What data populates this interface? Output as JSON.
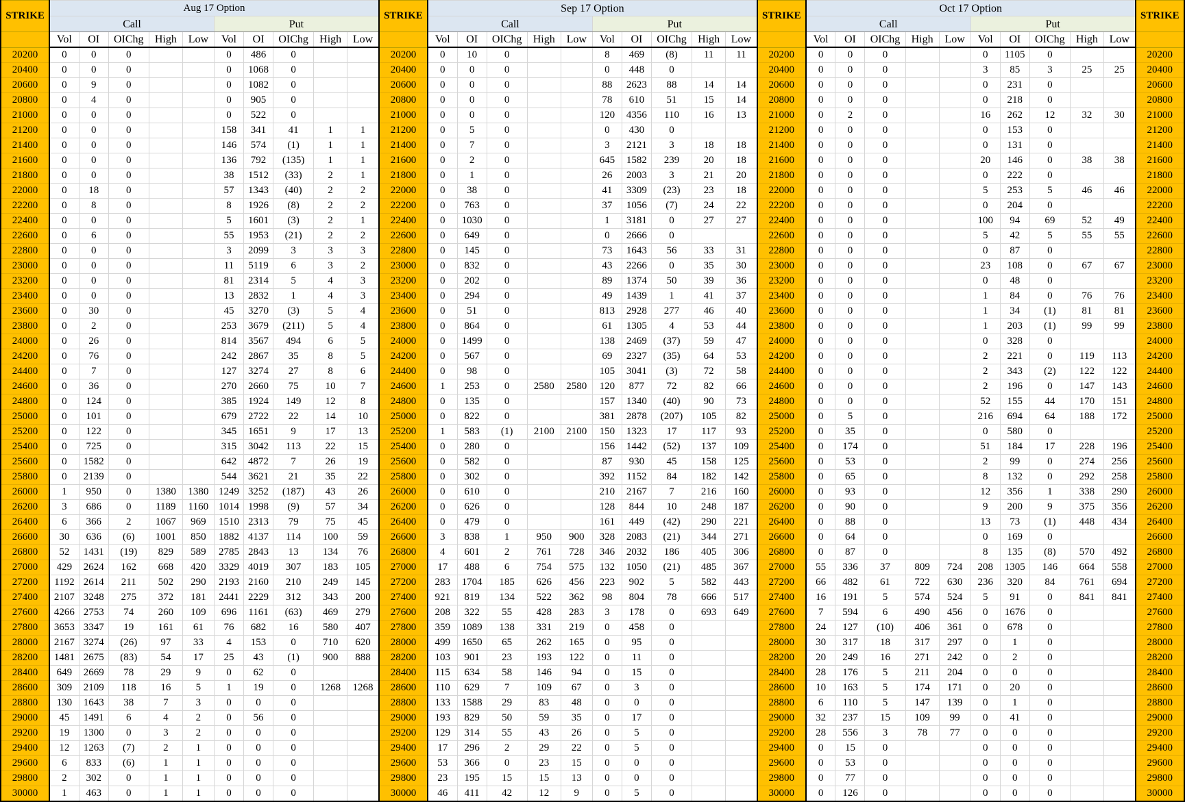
{
  "header": {
    "strike_label": "STRIKE",
    "call_label": "Call",
    "put_label": "Put",
    "sub_columns": [
      "Vol",
      "OI",
      "OIChg",
      "High",
      "Low"
    ]
  },
  "months": [
    "Aug 17 Option",
    "Sep 17 Option",
    "Oct 17 Option"
  ],
  "colors": {
    "strike_bg": "#ffc000",
    "call_bg": "#dce6f1",
    "put_bg": "#ebf1de",
    "negative": "#ff0000"
  },
  "rows": [
    [
      "20200",
      "0",
      "0",
      "0",
      "",
      "",
      "0",
      "486",
      "0",
      "",
      "",
      "0",
      "10",
      "0",
      "",
      "",
      "8",
      "469",
      "(8)",
      "11",
      "11",
      "0",
      "0",
      "0",
      "",
      "",
      "0",
      "1105",
      "0",
      "",
      ""
    ],
    [
      "20400",
      "0",
      "0",
      "0",
      "",
      "",
      "0",
      "1068",
      "0",
      "",
      "",
      "0",
      "0",
      "0",
      "",
      "",
      "0",
      "448",
      "0",
      "",
      "",
      "0",
      "0",
      "0",
      "",
      "",
      "3",
      "85",
      "3",
      "25",
      "25"
    ],
    [
      "20600",
      "0",
      "9",
      "0",
      "",
      "",
      "0",
      "1082",
      "0",
      "",
      "",
      "0",
      "0",
      "0",
      "",
      "",
      "88",
      "2623",
      "88",
      "14",
      "14",
      "0",
      "0",
      "0",
      "",
      "",
      "0",
      "231",
      "0",
      "",
      ""
    ],
    [
      "20800",
      "0",
      "4",
      "0",
      "",
      "",
      "0",
      "905",
      "0",
      "",
      "",
      "0",
      "0",
      "0",
      "",
      "",
      "78",
      "610",
      "51",
      "15",
      "14",
      "0",
      "0",
      "0",
      "",
      "",
      "0",
      "218",
      "0",
      "",
      ""
    ],
    [
      "21000",
      "0",
      "0",
      "0",
      "",
      "",
      "0",
      "522",
      "0",
      "",
      "",
      "0",
      "0",
      "0",
      "",
      "",
      "120",
      "4356",
      "110",
      "16",
      "13",
      "0",
      "2",
      "0",
      "",
      "",
      "16",
      "262",
      "12",
      "32",
      "30"
    ],
    [
      "21200",
      "0",
      "0",
      "0",
      "",
      "",
      "158",
      "341",
      "41",
      "1",
      "1",
      "0",
      "5",
      "0",
      "",
      "",
      "0",
      "430",
      "0",
      "",
      "",
      "0",
      "0",
      "0",
      "",
      "",
      "0",
      "153",
      "0",
      "",
      ""
    ],
    [
      "21400",
      "0",
      "0",
      "0",
      "",
      "",
      "146",
      "574",
      "(1)",
      "1",
      "1",
      "0",
      "7",
      "0",
      "",
      "",
      "3",
      "2121",
      "3",
      "18",
      "18",
      "0",
      "0",
      "0",
      "",
      "",
      "0",
      "131",
      "0",
      "",
      ""
    ],
    [
      "21600",
      "0",
      "0",
      "0",
      "",
      "",
      "136",
      "792",
      "(135)",
      "1",
      "1",
      "0",
      "2",
      "0",
      "",
      "",
      "645",
      "1582",
      "239",
      "20",
      "18",
      "0",
      "0",
      "0",
      "",
      "",
      "20",
      "146",
      "0",
      "38",
      "38"
    ],
    [
      "21800",
      "0",
      "0",
      "0",
      "",
      "",
      "38",
      "1512",
      "(33)",
      "2",
      "1",
      "0",
      "1",
      "0",
      "",
      "",
      "26",
      "2003",
      "3",
      "21",
      "20",
      "0",
      "0",
      "0",
      "",
      "",
      "0",
      "222",
      "0",
      "",
      ""
    ],
    [
      "22000",
      "0",
      "18",
      "0",
      "",
      "",
      "57",
      "1343",
      "(40)",
      "2",
      "2",
      "0",
      "38",
      "0",
      "",
      "",
      "41",
      "3309",
      "(23)",
      "23",
      "18",
      "0",
      "0",
      "0",
      "",
      "",
      "5",
      "253",
      "5",
      "46",
      "46"
    ],
    [
      "22200",
      "0",
      "8",
      "0",
      "",
      "",
      "8",
      "1926",
      "(8)",
      "2",
      "2",
      "0",
      "763",
      "0",
      "",
      "",
      "37",
      "1056",
      "(7)",
      "24",
      "22",
      "0",
      "0",
      "0",
      "",
      "",
      "0",
      "204",
      "0",
      "",
      ""
    ],
    [
      "22400",
      "0",
      "0",
      "0",
      "",
      "",
      "5",
      "1601",
      "(3)",
      "2",
      "1",
      "0",
      "1030",
      "0",
      "",
      "",
      "1",
      "3181",
      "0",
      "27",
      "27",
      "0",
      "0",
      "0",
      "",
      "",
      "100",
      "94",
      "69",
      "52",
      "49"
    ],
    [
      "22600",
      "0",
      "6",
      "0",
      "",
      "",
      "55",
      "1953",
      "(21)",
      "2",
      "2",
      "0",
      "649",
      "0",
      "",
      "",
      "0",
      "2666",
      "0",
      "",
      "",
      "0",
      "0",
      "0",
      "",
      "",
      "5",
      "42",
      "5",
      "55",
      "55"
    ],
    [
      "22800",
      "0",
      "0",
      "0",
      "",
      "",
      "3",
      "2099",
      "3",
      "3",
      "3",
      "0",
      "145",
      "0",
      "",
      "",
      "73",
      "1643",
      "56",
      "33",
      "31",
      "0",
      "0",
      "0",
      "",
      "",
      "0",
      "87",
      "0",
      "",
      ""
    ],
    [
      "23000",
      "0",
      "0",
      "0",
      "",
      "",
      "11",
      "5119",
      "6",
      "3",
      "2",
      "0",
      "832",
      "0",
      "",
      "",
      "43",
      "2266",
      "0",
      "35",
      "30",
      "0",
      "0",
      "0",
      "",
      "",
      "23",
      "108",
      "0",
      "67",
      "67"
    ],
    [
      "23200",
      "0",
      "0",
      "0",
      "",
      "",
      "81",
      "2314",
      "5",
      "4",
      "3",
      "0",
      "202",
      "0",
      "",
      "",
      "89",
      "1374",
      "50",
      "39",
      "36",
      "0",
      "0",
      "0",
      "",
      "",
      "0",
      "48",
      "0",
      "",
      ""
    ],
    [
      "23400",
      "0",
      "0",
      "0",
      "",
      "",
      "13",
      "2832",
      "1",
      "4",
      "3",
      "0",
      "294",
      "0",
      "",
      "",
      "49",
      "1439",
      "1",
      "41",
      "37",
      "0",
      "0",
      "0",
      "",
      "",
      "1",
      "84",
      "0",
      "76",
      "76"
    ],
    [
      "23600",
      "0",
      "30",
      "0",
      "",
      "",
      "45",
      "3270",
      "(3)",
      "5",
      "4",
      "0",
      "51",
      "0",
      "",
      "",
      "813",
      "2928",
      "277",
      "46",
      "40",
      "0",
      "0",
      "0",
      "",
      "",
      "1",
      "34",
      "(1)",
      "81",
      "81"
    ],
    [
      "23800",
      "0",
      "2",
      "0",
      "",
      "",
      "253",
      "3679",
      "(211)",
      "5",
      "4",
      "0",
      "864",
      "0",
      "",
      "",
      "61",
      "1305",
      "4",
      "53",
      "44",
      "0",
      "0",
      "0",
      "",
      "",
      "1",
      "203",
      "(1)",
      "99",
      "99"
    ],
    [
      "24000",
      "0",
      "26",
      "0",
      "",
      "",
      "814",
      "3567",
      "494",
      "6",
      "5",
      "0",
      "1499",
      "0",
      "",
      "",
      "138",
      "2469",
      "(37)",
      "59",
      "47",
      "0",
      "0",
      "0",
      "",
      "",
      "0",
      "328",
      "0",
      "",
      ""
    ],
    [
      "24200",
      "0",
      "76",
      "0",
      "",
      "",
      "242",
      "2867",
      "35",
      "8",
      "5",
      "0",
      "567",
      "0",
      "",
      "",
      "69",
      "2327",
      "(35)",
      "64",
      "53",
      "0",
      "0",
      "0",
      "",
      "",
      "2",
      "221",
      "0",
      "119",
      "113"
    ],
    [
      "24400",
      "0",
      "7",
      "0",
      "",
      "",
      "127",
      "3274",
      "27",
      "8",
      "6",
      "0",
      "98",
      "0",
      "",
      "",
      "105",
      "3041",
      "(3)",
      "72",
      "58",
      "0",
      "0",
      "0",
      "",
      "",
      "2",
      "343",
      "(2)",
      "122",
      "122"
    ],
    [
      "24600",
      "0",
      "36",
      "0",
      "",
      "",
      "270",
      "2660",
      "75",
      "10",
      "7",
      "1",
      "253",
      "0",
      "2580",
      "2580",
      "120",
      "877",
      "72",
      "82",
      "66",
      "0",
      "0",
      "0",
      "",
      "",
      "2",
      "196",
      "0",
      "147",
      "143"
    ],
    [
      "24800",
      "0",
      "124",
      "0",
      "",
      "",
      "385",
      "1924",
      "149",
      "12",
      "8",
      "0",
      "135",
      "0",
      "",
      "",
      "157",
      "1340",
      "(40)",
      "90",
      "73",
      "0",
      "0",
      "0",
      "",
      "",
      "52",
      "155",
      "44",
      "170",
      "151"
    ],
    [
      "25000",
      "0",
      "101",
      "0",
      "",
      "",
      "679",
      "2722",
      "22",
      "14",
      "10",
      "0",
      "822",
      "0",
      "",
      "",
      "381",
      "2878",
      "(207)",
      "105",
      "82",
      "0",
      "5",
      "0",
      "",
      "",
      "216",
      "694",
      "64",
      "188",
      "172"
    ],
    [
      "25200",
      "0",
      "122",
      "0",
      "",
      "",
      "345",
      "1651",
      "9",
      "17",
      "13",
      "1",
      "583",
      "(1)",
      "2100",
      "2100",
      "150",
      "1323",
      "17",
      "117",
      "93",
      "0",
      "35",
      "0",
      "",
      "",
      "0",
      "580",
      "0",
      "",
      ""
    ],
    [
      "25400",
      "0",
      "725",
      "0",
      "",
      "",
      "315",
      "3042",
      "113",
      "22",
      "15",
      "0",
      "280",
      "0",
      "",
      "",
      "156",
      "1442",
      "(52)",
      "137",
      "109",
      "0",
      "174",
      "0",
      "",
      "",
      "51",
      "184",
      "17",
      "228",
      "196"
    ],
    [
      "25600",
      "0",
      "1582",
      "0",
      "",
      "",
      "642",
      "4872",
      "7",
      "26",
      "19",
      "0",
      "582",
      "0",
      "",
      "",
      "87",
      "930",
      "45",
      "158",
      "125",
      "0",
      "53",
      "0",
      "",
      "",
      "2",
      "99",
      "0",
      "274",
      "256"
    ],
    [
      "25800",
      "0",
      "2139",
      "0",
      "",
      "",
      "544",
      "3621",
      "21",
      "35",
      "22",
      "0",
      "302",
      "0",
      "",
      "",
      "392",
      "1152",
      "84",
      "182",
      "142",
      "0",
      "65",
      "0",
      "",
      "",
      "8",
      "132",
      "0",
      "292",
      "258"
    ],
    [
      "26000",
      "1",
      "950",
      "0",
      "1380",
      "1380",
      "1249",
      "3252",
      "(187)",
      "43",
      "26",
      "0",
      "610",
      "0",
      "",
      "",
      "210",
      "2167",
      "7",
      "216",
      "160",
      "0",
      "93",
      "0",
      "",
      "",
      "12",
      "356",
      "1",
      "338",
      "290"
    ],
    [
      "26200",
      "3",
      "686",
      "0",
      "1189",
      "1160",
      "1014",
      "1998",
      "(9)",
      "57",
      "34",
      "0",
      "626",
      "0",
      "",
      "",
      "128",
      "844",
      "10",
      "248",
      "187",
      "0",
      "90",
      "0",
      "",
      "",
      "9",
      "200",
      "9",
      "375",
      "356"
    ],
    [
      "26400",
      "6",
      "366",
      "2",
      "1067",
      "969",
      "1510",
      "2313",
      "79",
      "75",
      "45",
      "0",
      "479",
      "0",
      "",
      "",
      "161",
      "449",
      "(42)",
      "290",
      "221",
      "0",
      "88",
      "0",
      "",
      "",
      "13",
      "73",
      "(1)",
      "448",
      "434"
    ],
    [
      "26600",
      "30",
      "636",
      "(6)",
      "1001",
      "850",
      "1882",
      "4137",
      "114",
      "100",
      "59",
      "3",
      "838",
      "1",
      "950",
      "900",
      "328",
      "2083",
      "(21)",
      "344",
      "271",
      "0",
      "64",
      "0",
      "",
      "",
      "0",
      "169",
      "0",
      "",
      ""
    ],
    [
      "26800",
      "52",
      "1431",
      "(19)",
      "829",
      "589",
      "2785",
      "2843",
      "13",
      "134",
      "76",
      "4",
      "601",
      "2",
      "761",
      "728",
      "346",
      "2032",
      "186",
      "405",
      "306",
      "0",
      "87",
      "0",
      "",
      "",
      "8",
      "135",
      "(8)",
      "570",
      "492"
    ],
    [
      "27000",
      "429",
      "2624",
      "162",
      "668",
      "420",
      "3329",
      "4019",
      "307",
      "183",
      "105",
      "17",
      "488",
      "6",
      "754",
      "575",
      "132",
      "1050",
      "(21)",
      "485",
      "367",
      "55",
      "336",
      "37",
      "809",
      "724",
      "208",
      "1305",
      "146",
      "664",
      "558"
    ],
    [
      "27200",
      "1192",
      "2614",
      "211",
      "502",
      "290",
      "2193",
      "2160",
      "210",
      "249",
      "145",
      "283",
      "1704",
      "185",
      "626",
      "456",
      "223",
      "902",
      "5",
      "582",
      "443",
      "66",
      "482",
      "61",
      "722",
      "630",
      "236",
      "320",
      "84",
      "761",
      "694"
    ],
    [
      "27400",
      "2107",
      "3248",
      "275",
      "372",
      "181",
      "2441",
      "2229",
      "312",
      "343",
      "200",
      "921",
      "819",
      "134",
      "522",
      "362",
      "98",
      "804",
      "78",
      "666",
      "517",
      "16",
      "191",
      "5",
      "574",
      "524",
      "5",
      "91",
      "0",
      "841",
      "841"
    ],
    [
      "27600",
      "4266",
      "2753",
      "74",
      "260",
      "109",
      "696",
      "1161",
      "(63)",
      "469",
      "279",
      "208",
      "322",
      "55",
      "428",
      "283",
      "3",
      "178",
      "0",
      "693",
      "649",
      "7",
      "594",
      "6",
      "490",
      "456",
      "0",
      "1676",
      "0",
      "",
      ""
    ],
    [
      "27800",
      "3653",
      "3347",
      "19",
      "161",
      "61",
      "76",
      "682",
      "16",
      "580",
      "407",
      "359",
      "1089",
      "138",
      "331",
      "219",
      "0",
      "458",
      "0",
      "",
      "",
      "24",
      "127",
      "(10)",
      "406",
      "361",
      "0",
      "678",
      "0",
      "",
      ""
    ],
    [
      "28000",
      "2167",
      "3274",
      "(26)",
      "97",
      "33",
      "4",
      "153",
      "0",
      "710",
      "620",
      "499",
      "1650",
      "65",
      "262",
      "165",
      "0",
      "95",
      "0",
      "",
      "",
      "30",
      "317",
      "18",
      "317",
      "297",
      "0",
      "1",
      "0",
      "",
      ""
    ],
    [
      "28200",
      "1481",
      "2675",
      "(83)",
      "54",
      "17",
      "25",
      "43",
      "(1)",
      "900",
      "888",
      "103",
      "901",
      "23",
      "193",
      "122",
      "0",
      "11",
      "0",
      "",
      "",
      "20",
      "249",
      "16",
      "271",
      "242",
      "0",
      "2",
      "0",
      "",
      ""
    ],
    [
      "28400",
      "649",
      "2669",
      "78",
      "29",
      "9",
      "0",
      "62",
      "0",
      "",
      "",
      "115",
      "634",
      "58",
      "146",
      "94",
      "0",
      "15",
      "0",
      "",
      "",
      "28",
      "176",
      "5",
      "211",
      "204",
      "0",
      "0",
      "0",
      "",
      ""
    ],
    [
      "28600",
      "309",
      "2109",
      "118",
      "16",
      "5",
      "1",
      "19",
      "0",
      "1268",
      "1268",
      "110",
      "629",
      "7",
      "109",
      "67",
      "0",
      "3",
      "0",
      "",
      "",
      "10",
      "163",
      "5",
      "174",
      "171",
      "0",
      "20",
      "0",
      "",
      ""
    ],
    [
      "28800",
      "130",
      "1643",
      "38",
      "7",
      "3",
      "0",
      "0",
      "0",
      "",
      "",
      "133",
      "1588",
      "29",
      "83",
      "48",
      "0",
      "0",
      "0",
      "",
      "",
      "6",
      "110",
      "5",
      "147",
      "139",
      "0",
      "1",
      "0",
      "",
      ""
    ],
    [
      "29000",
      "45",
      "1491",
      "6",
      "4",
      "2",
      "0",
      "56",
      "0",
      "",
      "",
      "193",
      "829",
      "50",
      "59",
      "35",
      "0",
      "17",
      "0",
      "",
      "",
      "32",
      "237",
      "15",
      "109",
      "99",
      "0",
      "41",
      "0",
      "",
      ""
    ],
    [
      "29200",
      "19",
      "1300",
      "0",
      "3",
      "2",
      "0",
      "0",
      "0",
      "",
      "",
      "129",
      "314",
      "55",
      "43",
      "26",
      "0",
      "5",
      "0",
      "",
      "",
      "28",
      "556",
      "3",
      "78",
      "77",
      "0",
      "0",
      "0",
      "",
      ""
    ],
    [
      "29400",
      "12",
      "1263",
      "(7)",
      "2",
      "1",
      "0",
      "0",
      "0",
      "",
      "",
      "17",
      "296",
      "2",
      "29",
      "22",
      "0",
      "5",
      "0",
      "",
      "",
      "0",
      "15",
      "0",
      "",
      "",
      "0",
      "0",
      "0",
      "",
      ""
    ],
    [
      "29600",
      "6",
      "833",
      "(6)",
      "1",
      "1",
      "0",
      "0",
      "0",
      "",
      "",
      "53",
      "366",
      "0",
      "23",
      "15",
      "0",
      "0",
      "0",
      "",
      "",
      "0",
      "53",
      "0",
      "",
      "",
      "0",
      "0",
      "0",
      "",
      ""
    ],
    [
      "29800",
      "2",
      "302",
      "0",
      "1",
      "1",
      "0",
      "0",
      "0",
      "",
      "",
      "23",
      "195",
      "15",
      "15",
      "13",
      "0",
      "0",
      "0",
      "",
      "",
      "0",
      "77",
      "0",
      "",
      "",
      "0",
      "0",
      "0",
      "",
      ""
    ],
    [
      "30000",
      "1",
      "463",
      "0",
      "1",
      "1",
      "0",
      "0",
      "0",
      "",
      "",
      "46",
      "411",
      "42",
      "12",
      "9",
      "0",
      "5",
      "0",
      "",
      "",
      "0",
      "126",
      "0",
      "",
      "",
      "0",
      "0",
      "0",
      "",
      ""
    ]
  ]
}
